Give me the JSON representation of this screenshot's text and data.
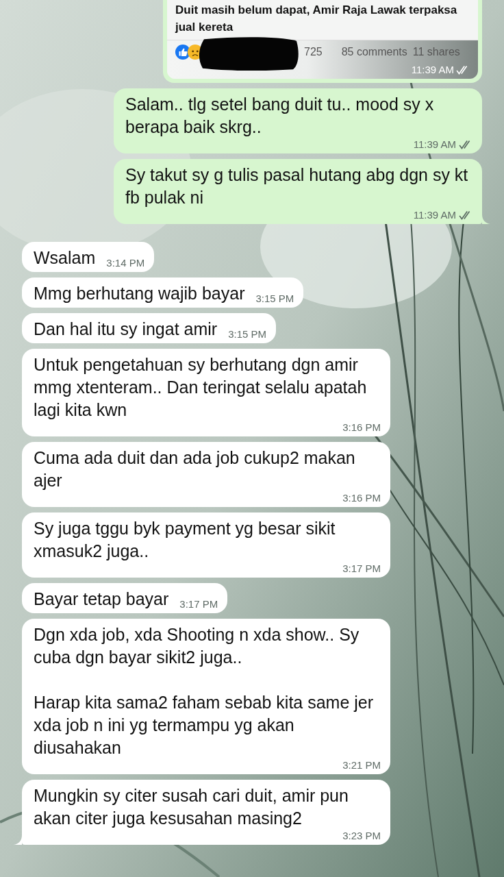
{
  "shared_post": {
    "title": "Duit masih belum dapat, Amir Raja Lawak terpaksa jual kereta",
    "reactions_count": "725",
    "comments": "85 comments",
    "shares": "11 shares",
    "time": "11:39 AM",
    "read": true
  },
  "messages": [
    {
      "kind": "outgoing",
      "text": "Salam.. tlg setel bang duit tu.. mood sy x berapa baik skrg..",
      "time": "11:39 AM",
      "read": true,
      "tail": false
    },
    {
      "kind": "outgoing",
      "text": "Sy takut sy g tulis pasal hutang abg dgn sy kt fb pulak ni",
      "time": "11:39 AM",
      "read": true,
      "tail": true
    },
    {
      "kind": "incoming",
      "text": "Wsalam",
      "time": "3:14 PM",
      "tail": false
    },
    {
      "kind": "incoming",
      "text": "Mmg berhutang wajib bayar",
      "time": "3:15 PM",
      "tail": false
    },
    {
      "kind": "incoming",
      "text": "Dan hal itu sy ingat amir",
      "time": "3:15 PM",
      "tail": false
    },
    {
      "kind": "incoming",
      "text": "Untuk pengetahuan sy berhutang dgn amir mmg xtenteram.. Dan teringat selalu apatah lagi kita kwn",
      "time": "3:16 PM",
      "tail": false
    },
    {
      "kind": "incoming",
      "text": "Cuma ada duit dan ada job cukup2 makan ajer",
      "time": "3:16 PM",
      "tail": false
    },
    {
      "kind": "incoming",
      "text": "Sy juga tggu byk payment yg besar sikit xmasuk2 juga..",
      "time": "3:17 PM",
      "tail": false
    },
    {
      "kind": "incoming",
      "text": "Bayar tetap bayar",
      "time": "3:17 PM",
      "tail": false
    },
    {
      "kind": "incoming",
      "text": "Dgn xda job, xda Shooting n xda show.. Sy cuba dgn bayar sikit2 juga..\n\nHarap kita sama2 faham sebab kita same jer xda job n ini yg termampu yg akan diusahakan",
      "time": "3:21 PM",
      "tail": false
    },
    {
      "kind": "incoming",
      "text": "Mungkin sy citer susah cari duit, amir pun akan citer juga kesusahan masing2",
      "time": "3:23 PM",
      "tail": true
    }
  ]
}
